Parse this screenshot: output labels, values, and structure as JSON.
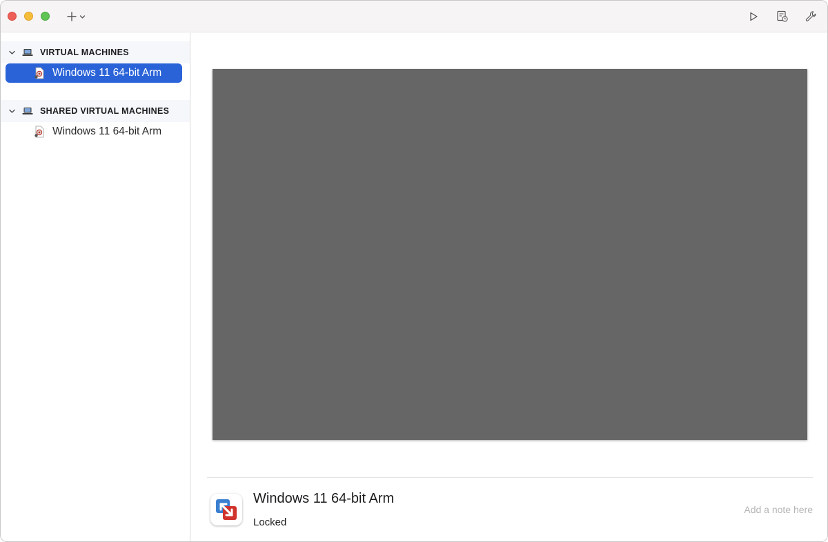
{
  "sidebar": {
    "sections": [
      {
        "title": "VIRTUAL MACHINES",
        "items": [
          {
            "label": "Windows 11 64-bit Arm",
            "selected": true
          }
        ]
      },
      {
        "title": "SHARED VIRTUAL MACHINES",
        "items": [
          {
            "label": "Windows 11 64-bit Arm",
            "selected": false
          }
        ]
      }
    ]
  },
  "toolbar": {
    "add_icon": "plus-icon",
    "add_dropdown_icon": "chevron-down-icon",
    "actions": [
      "play-icon",
      "snapshot-icon",
      "wrench-icon"
    ]
  },
  "detail": {
    "vm_name": "Windows 11 64-bit Arm",
    "status": "Locked",
    "note_placeholder": "Add a note here",
    "app_icon": "vmware-fusion-icon"
  },
  "colors": {
    "selection": "#2a63d8",
    "preview_background": "#666666",
    "titlebar": "#f6f4f5",
    "section_header": "#f5f7fb"
  }
}
